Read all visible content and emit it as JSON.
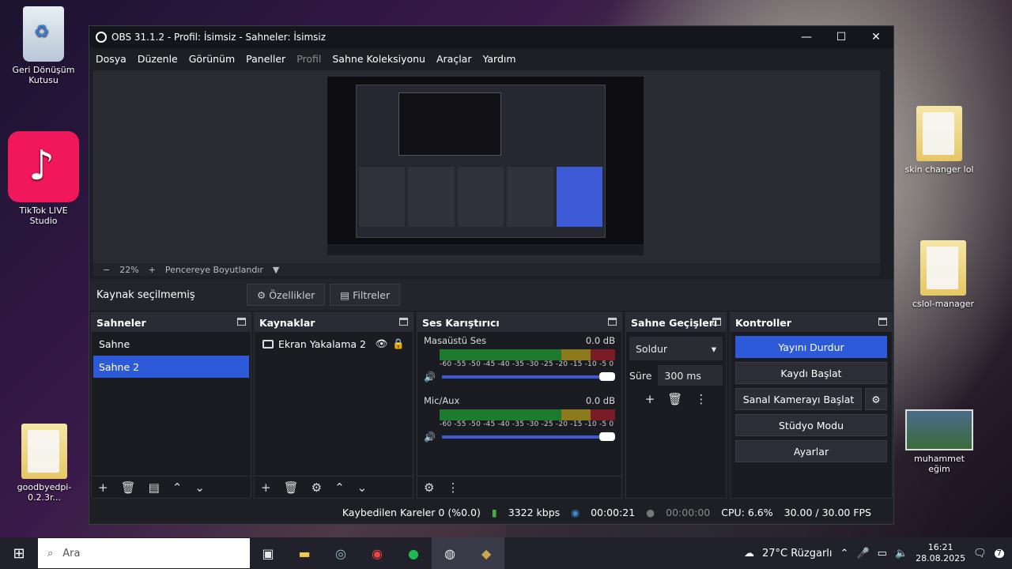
{
  "desktop": {
    "icons": [
      {
        "label": "Geri Dönüşüm Kutusu"
      },
      {
        "label": "TikTok LIVE Studio"
      },
      {
        "label": "goodbyedpi-0.2.3r..."
      },
      {
        "label": "skin changer lol"
      },
      {
        "label": "cslol-manager"
      },
      {
        "label": "muhammet eğim"
      }
    ]
  },
  "window": {
    "title": "OBS 31.1.2 - Profil: İsimsiz - Sahneler: İsimsiz",
    "minimize": "—",
    "maximize": "☐",
    "close": "✕"
  },
  "menu": [
    "Dosya",
    "Düzenle",
    "Görünüm",
    "Paneller",
    "Profil",
    "Sahne Koleksiyonu",
    "Araçlar",
    "Yardım"
  ],
  "zoom": {
    "minus": "−",
    "value": "22%",
    "plus": "+",
    "mode": "Pencereye Boyutlandır",
    "caret": "▼"
  },
  "source_bar": {
    "no_source": "Kaynak seçilmemiş",
    "properties": "Özellikler",
    "filters": "Filtreler"
  },
  "scenes": {
    "title": "Sahneler",
    "items": [
      "Sahne",
      "Sahne 2"
    ],
    "selected": 1
  },
  "sources": {
    "title": "Kaynaklar",
    "items": [
      {
        "label": "Ekran Yakalama 2"
      }
    ]
  },
  "mixer": {
    "title": "Ses Karıştırıcı",
    "channels": [
      {
        "name": "Masaüstü Ses",
        "level": "0.0 dB"
      },
      {
        "name": "Mic/Aux",
        "level": "0.0 dB"
      }
    ],
    "ticks": "-60 -55 -50 -45 -40 -35 -30 -25 -20 -15 -10 -5 0"
  },
  "transitions": {
    "title": "Sahne Geçişleri",
    "type": "Soldur",
    "duration_label": "Süre",
    "duration": "300 ms"
  },
  "controls": {
    "title": "Kontroller",
    "stop_stream": "Yayını Durdur",
    "start_record": "Kaydı Başlat",
    "virtual_cam": "Sanal Kamerayı Başlat",
    "studio_mode": "Stüdyo Modu",
    "settings": "Ayarlar"
  },
  "status": {
    "dropped": "Kaybedilen Kareler 0 (%0.0)",
    "bitrate": "3322 kbps",
    "stream_time": "00:00:21",
    "record_time": "00:00:00",
    "cpu": "CPU: 6.6%",
    "fps": "30.00 / 30.00 FPS"
  },
  "taskbar": {
    "search_placeholder": "Ara",
    "weather": "27°C Rüzgarlı",
    "time": "16:21",
    "date": "28.08.2025",
    "notifications": "7"
  }
}
